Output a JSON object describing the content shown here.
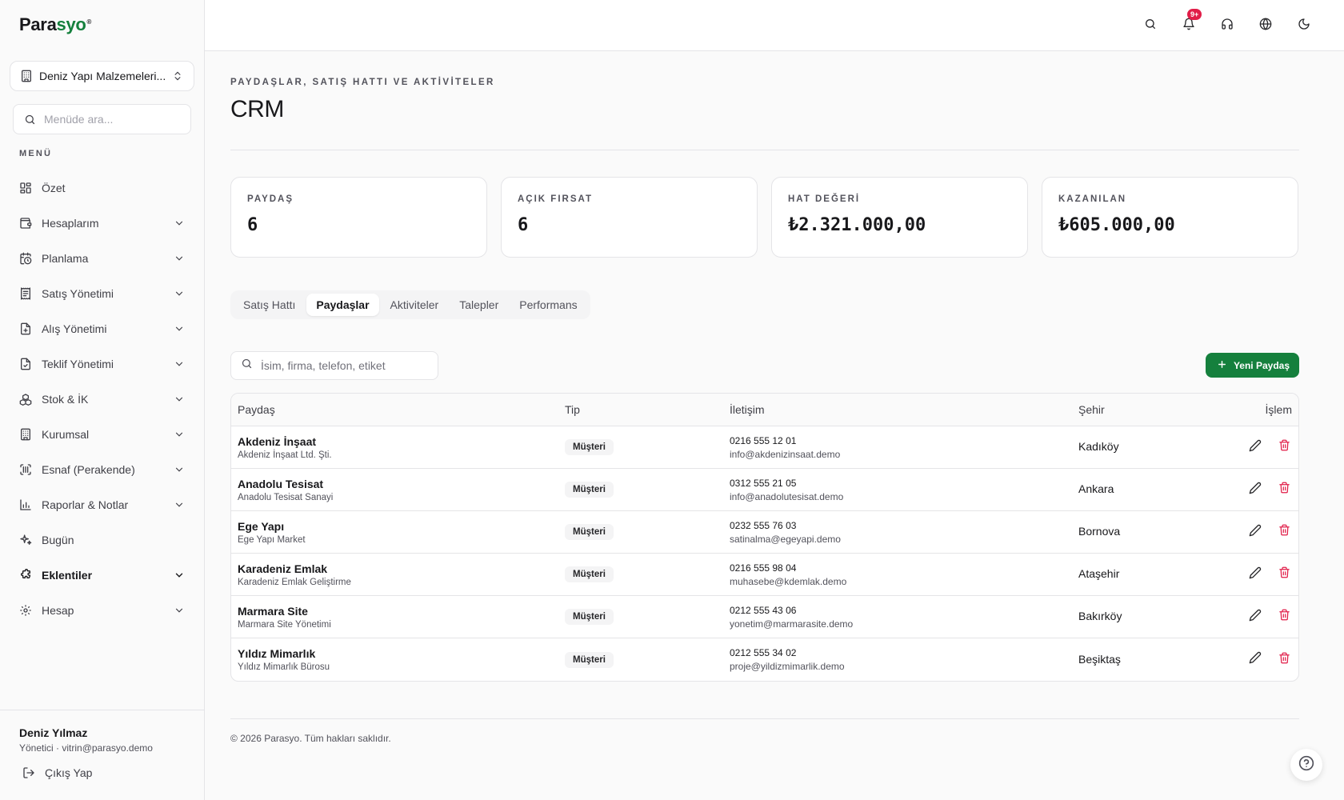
{
  "app": {
    "brand_main": "Para",
    "brand_accent": "syo",
    "brand_mark": "®"
  },
  "sidebar": {
    "company": "Deniz Yapı Malzemeleri...",
    "search_placeholder": "Menüde ara...",
    "menu_label": "MENÜ",
    "items": [
      {
        "label": "Özet",
        "icon": "grid-icon"
      },
      {
        "label": "Hesaplarım",
        "icon": "wallet-icon"
      },
      {
        "label": "Planlama",
        "icon": "calendar-clock-icon"
      },
      {
        "label": "Satış Yönetimi",
        "icon": "receipt-icon"
      },
      {
        "label": "Alış Yönetimi",
        "icon": "file-plus-icon"
      },
      {
        "label": "Teklif Yönetimi",
        "icon": "file-check-icon"
      },
      {
        "label": "Stok & İK",
        "icon": "boxes-icon"
      },
      {
        "label": "Kurumsal",
        "icon": "building-icon"
      },
      {
        "label": "Esnaf (Perakende)",
        "icon": "scan-icon"
      },
      {
        "label": "Raporlar & Notlar",
        "icon": "bar-chart-icon"
      },
      {
        "label": "Bugün",
        "icon": "sparkles-icon"
      },
      {
        "label": "Eklentiler",
        "icon": "puzzle-icon"
      },
      {
        "label": "Hesap",
        "icon": "settings-icon"
      }
    ],
    "user": {
      "name": "Deniz Yılmaz",
      "role_email": "Yönetici · vitrin@parasyo.demo"
    },
    "logout": "Çıkış Yap"
  },
  "topbar": {
    "notification_badge": "9+"
  },
  "page": {
    "eyebrow": "PAYDAŞLAR, SATIŞ HATTI VE AKTİVİTELER",
    "title": "CRM"
  },
  "stats": [
    {
      "label": "PAYDAŞ",
      "value": "6"
    },
    {
      "label": "AÇIK FIRSAT",
      "value": "6"
    },
    {
      "label": "HAT DEĞERİ",
      "value": "₺2.321.000,00"
    },
    {
      "label": "KAZANILAN",
      "value": "₺605.000,00"
    }
  ],
  "tabs": [
    "Satış Hattı",
    "Paydaşlar",
    "Aktiviteler",
    "Talepler",
    "Performans"
  ],
  "active_tab": "Paydaşlar",
  "search": {
    "placeholder": "İsim, firma, telefon, etiket"
  },
  "new_button": "Yeni Paydaş",
  "table": {
    "headers": [
      "Paydaş",
      "Tip",
      "İletişim",
      "Şehir",
      "İşlem"
    ],
    "rows": [
      {
        "name": "Akdeniz İnşaat",
        "company": "Akdeniz İnşaat Ltd. Şti.",
        "type": "Müşteri",
        "phone": "0216 555 12 01",
        "email": "info@akdenizinsaat.demo",
        "city": "Kadıköy"
      },
      {
        "name": "Anadolu Tesisat",
        "company": "Anadolu Tesisat Sanayi",
        "type": "Müşteri",
        "phone": "0312 555 21 05",
        "email": "info@anadolutesisat.demo",
        "city": "Ankara"
      },
      {
        "name": "Ege Yapı",
        "company": "Ege Yapı Market",
        "type": "Müşteri",
        "phone": "0232 555 76 03",
        "email": "satinalma@egeyapi.demo",
        "city": "Bornova"
      },
      {
        "name": "Karadeniz Emlak",
        "company": "Karadeniz Emlak Geliştirme",
        "type": "Müşteri",
        "phone": "0216 555 98 04",
        "email": "muhasebe@kdemlak.demo",
        "city": "Ataşehir"
      },
      {
        "name": "Marmara Site",
        "company": "Marmara Site Yönetimi",
        "type": "Müşteri",
        "phone": "0212 555 43 06",
        "email": "yonetim@marmarasite.demo",
        "city": "Bakırköy"
      },
      {
        "name": "Yıldız Mimarlık",
        "company": "Yıldız Mimarlık Bürosu",
        "type": "Müşteri",
        "phone": "0212 555 34 02",
        "email": "proje@yildizmimarlik.demo",
        "city": "Beşiktaş"
      }
    ]
  },
  "footer": {
    "copyright": "© 2026 Parasyo. Tüm hakları saklıdır."
  },
  "colors": {
    "accent": "#15803d",
    "danger": "#e11d48",
    "border": "#e4e4e7"
  }
}
